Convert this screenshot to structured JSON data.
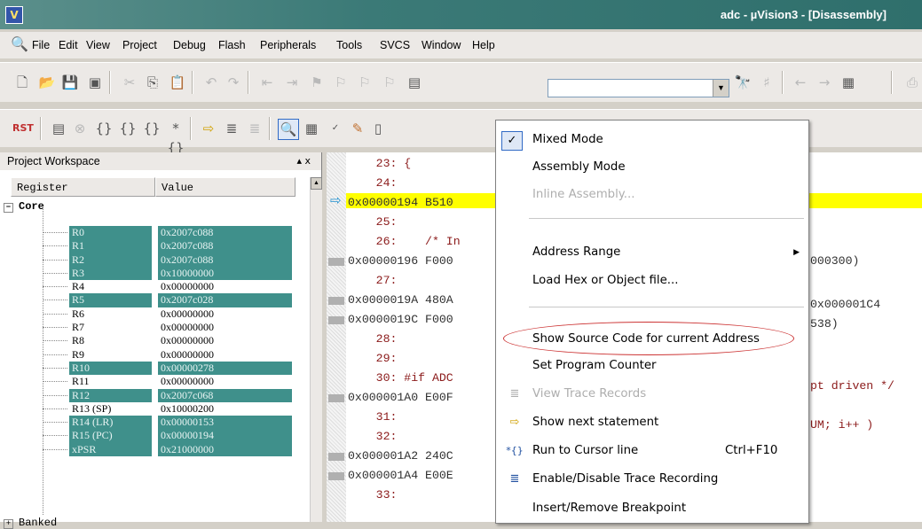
{
  "window": {
    "title": "adc - µVision3 - [Disassembly]"
  },
  "menu": [
    "File",
    "Edit",
    "View",
    "Project",
    "Debug",
    "Flash",
    "Peripherals",
    "Tools",
    "SVCS",
    "Window",
    "Help"
  ],
  "workspace": {
    "title": "Project Workspace",
    "controls": "▴ x",
    "col_register": "Register",
    "col_value": "Value",
    "core_label": "Core",
    "next_group": "Banked",
    "registers": [
      {
        "name": "R0",
        "value": "0x2007c088",
        "selected": true
      },
      {
        "name": "R1",
        "value": "0x2007c088",
        "selected": true
      },
      {
        "name": "R2",
        "value": "0x2007c088",
        "selected": true
      },
      {
        "name": "R3",
        "value": "0x10000000",
        "selected": true
      },
      {
        "name": "R4",
        "value": "0x00000000",
        "selected": false
      },
      {
        "name": "R5",
        "value": "0x2007c028",
        "selected": true
      },
      {
        "name": "R6",
        "value": "0x00000000",
        "selected": false
      },
      {
        "name": "R7",
        "value": "0x00000000",
        "selected": false
      },
      {
        "name": "R8",
        "value": "0x00000000",
        "selected": false
      },
      {
        "name": "R9",
        "value": "0x00000000",
        "selected": false
      },
      {
        "name": "R10",
        "value": "0x00000278",
        "selected": true
      },
      {
        "name": "R11",
        "value": "0x00000000",
        "selected": false
      },
      {
        "name": "R12",
        "value": "0x2007c068",
        "selected": true
      },
      {
        "name": "R13 (SP)",
        "value": "0x10000200",
        "selected": false
      },
      {
        "name": "R14 (LR)",
        "value": "0x00000153",
        "selected": true
      },
      {
        "name": "R15 (PC)",
        "value": "0x00000194",
        "selected": true
      },
      {
        "name": "xPSR",
        "value": "0x21000000",
        "selected": true
      }
    ]
  },
  "disassembly": [
    {
      "text": "    23: {",
      "kind": "src"
    },
    {
      "text": "    24:",
      "kind": "src"
    },
    {
      "text": "0x00000194 B510",
      "kind": "addr",
      "current": true
    },
    {
      "text": "    25:",
      "kind": "src"
    },
    {
      "text": "    26:    /* In",
      "kind": "src"
    },
    {
      "text": "0x00000196 F000",
      "kind": "addr"
    },
    {
      "text": "    27:",
      "kind": "src"
    },
    {
      "text": "0x0000019A 480A",
      "kind": "addr"
    },
    {
      "text": "0x0000019C F000",
      "kind": "addr"
    },
    {
      "text": "    28:",
      "kind": "src"
    },
    {
      "text": "    29:",
      "kind": "src"
    },
    {
      "text": "    30: #if ADC",
      "kind": "src"
    },
    {
      "text": "0x000001A0 E00F",
      "kind": "addr"
    },
    {
      "text": "    31:",
      "kind": "src"
    },
    {
      "text": "    32:",
      "kind": "src"
    },
    {
      "text": "0x000001A2 240C",
      "kind": "addr"
    },
    {
      "text": "0x000001A4 E00E",
      "kind": "addr"
    },
    {
      "text": "    33:",
      "kind": "src"
    }
  ],
  "disassembly_tail": {
    "l26": "000300)",
    "l19a": "0x000001C4",
    "l19c": "538)",
    "l30": "pt driven */",
    "l31": "UM; i++ )"
  },
  "context_menu": {
    "mixed_mode": "Mixed Mode",
    "assembly_mode": "Assembly Mode",
    "inline_assembly": "Inline Assembly...",
    "address_range": "Address Range",
    "load_hex": "Load Hex or Object file...",
    "show_source": "Show Source Code for current Address",
    "set_pc": "Set Program Counter",
    "view_trace": "View Trace Records",
    "show_next": "Show next statement",
    "run_to_cursor": "Run to Cursor line",
    "run_to_cursor_shortcut": "Ctrl+F10",
    "enable_trace": "Enable/Disable Trace Recording",
    "insert_breakpoint": "Insert/Remove Breakpoint"
  },
  "colors": {
    "selection": "#3f908b",
    "current_line": "#ffff00",
    "title_bar": "#3b7a77",
    "annotation": "#cc3333"
  }
}
